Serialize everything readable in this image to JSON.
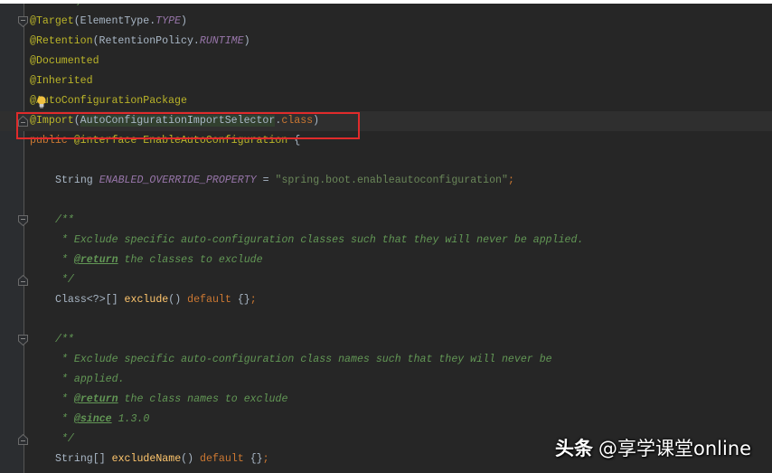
{
  "editor": {
    "language": "java",
    "top_partial": "*/",
    "lines": [
      {
        "tokens": [
          {
            "t": "@Target",
            "c": "ann"
          },
          {
            "t": "(ElementType.",
            "c": "plain"
          },
          {
            "t": "TYPE",
            "c": "const"
          },
          {
            "t": ")",
            "c": "plain"
          }
        ]
      },
      {
        "tokens": [
          {
            "t": "@Retention",
            "c": "ann"
          },
          {
            "t": "(RetentionPolicy.",
            "c": "plain"
          },
          {
            "t": "RUNTIME",
            "c": "const"
          },
          {
            "t": ")",
            "c": "plain"
          }
        ]
      },
      {
        "tokens": [
          {
            "t": "@Documented",
            "c": "ann"
          }
        ]
      },
      {
        "tokens": [
          {
            "t": "@Inherited",
            "c": "ann"
          }
        ]
      },
      {
        "tokens": [
          {
            "t": "@AutoConfigurationPackage",
            "c": "ann"
          }
        ]
      },
      {
        "tokens": [
          {
            "t": "@Import",
            "c": "ann"
          },
          {
            "t": "(",
            "c": "plain"
          },
          {
            "t": "AutoConfigurationImportSelector",
            "c": "plain sel-bg"
          },
          {
            "t": ".",
            "c": "plain"
          },
          {
            "t": "class",
            "c": "kw"
          },
          {
            "t": ")",
            "c": "plain"
          }
        ]
      },
      {
        "tokens": [
          {
            "t": "public ",
            "c": "kw"
          },
          {
            "t": "@interface ",
            "c": "ann"
          },
          {
            "t": "EnableAutoConfiguration ",
            "c": "ann"
          },
          {
            "t": "{",
            "c": "plain"
          }
        ]
      },
      {
        "tokens": []
      },
      {
        "indent": true,
        "tokens": [
          {
            "t": "String ",
            "c": "plain"
          },
          {
            "t": "ENABLED_OVERRIDE_PROPERTY",
            "c": "const"
          },
          {
            "t": " = ",
            "c": "plain"
          },
          {
            "t": "\"spring.boot.enableautoconfiguration\"",
            "c": "str"
          },
          {
            "t": ";",
            "c": "kw"
          }
        ]
      },
      {
        "tokens": []
      },
      {
        "indent": true,
        "tokens": [
          {
            "t": "/**",
            "c": "cmt"
          }
        ]
      },
      {
        "indent": true,
        "tokens": [
          {
            "t": " * Exclude specific auto-configuration classes such that they will never be applied.",
            "c": "cmt"
          }
        ]
      },
      {
        "indent": true,
        "tokens": [
          {
            "t": " * ",
            "c": "cmt"
          },
          {
            "t": "@return",
            "c": "tag"
          },
          {
            "t": " the classes to exclude",
            "c": "cmt"
          }
        ]
      },
      {
        "indent": true,
        "tokens": [
          {
            "t": " */",
            "c": "cmt"
          }
        ]
      },
      {
        "indent": true,
        "tokens": [
          {
            "t": "Class<?>[] ",
            "c": "plain"
          },
          {
            "t": "exclude",
            "c": "meth"
          },
          {
            "t": "() ",
            "c": "plain"
          },
          {
            "t": "default ",
            "c": "kw"
          },
          {
            "t": "{}",
            "c": "plain"
          },
          {
            "t": ";",
            "c": "kw"
          }
        ]
      },
      {
        "tokens": []
      },
      {
        "indent": true,
        "tokens": [
          {
            "t": "/**",
            "c": "cmt"
          }
        ]
      },
      {
        "indent": true,
        "tokens": [
          {
            "t": " * Exclude specific auto-configuration class names such that they will never be",
            "c": "cmt"
          }
        ]
      },
      {
        "indent": true,
        "tokens": [
          {
            "t": " * applied.",
            "c": "cmt"
          }
        ]
      },
      {
        "indent": true,
        "tokens": [
          {
            "t": " * ",
            "c": "cmt"
          },
          {
            "t": "@return",
            "c": "tag"
          },
          {
            "t": " the class names to exclude",
            "c": "cmt"
          }
        ]
      },
      {
        "indent": true,
        "tokens": [
          {
            "t": " * ",
            "c": "cmt"
          },
          {
            "t": "@since",
            "c": "tag"
          },
          {
            "t": " 1.3.0",
            "c": "cmt"
          }
        ]
      },
      {
        "indent": true,
        "tokens": [
          {
            "t": " */",
            "c": "cmt"
          }
        ]
      },
      {
        "indent": true,
        "tokens": [
          {
            "t": "String[] ",
            "c": "plain"
          },
          {
            "t": "excludeName",
            "c": "meth"
          },
          {
            "t": "() ",
            "c": "plain"
          },
          {
            "t": "default ",
            "c": "kw"
          },
          {
            "t": "{}",
            "c": "plain"
          },
          {
            "t": ";",
            "c": "kw"
          }
        ]
      }
    ],
    "current_line_index": 5,
    "highlighted_line_index": 5,
    "fold_markers": [
      {
        "line": 0,
        "type": "fold-start"
      },
      {
        "line": 5,
        "type": "fold-end"
      },
      {
        "line": 10,
        "type": "fold-start"
      },
      {
        "line": 13,
        "type": "fold-end"
      },
      {
        "line": 16,
        "type": "fold-start"
      },
      {
        "line": 21,
        "type": "fold-end"
      }
    ],
    "intention_icon": "lightbulb-icon"
  },
  "colors": {
    "editor_bg": "#262626",
    "gutter_bg": "#2b2d30",
    "current_line_bg": "#2f2f2f",
    "highlight_box": "#e02b2b",
    "annotation": "#bbb529",
    "keyword": "#cc7832",
    "constant": "#9876aa",
    "string": "#6a8759",
    "comment": "#629755",
    "method": "#ffc66d"
  },
  "watermark": {
    "brand": "头条",
    "handle": "@享学课堂online"
  }
}
